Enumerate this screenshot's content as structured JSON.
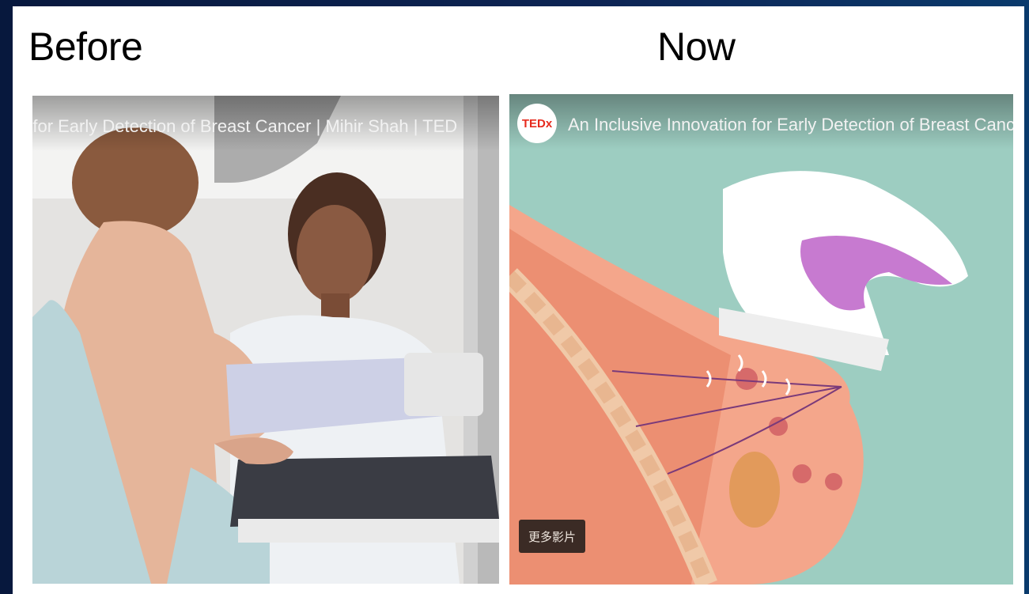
{
  "slide": {
    "before_heading": "Before",
    "now_heading": "Now"
  },
  "before_video": {
    "title": "n for Early Detection of Breast Cancer | Mihir Shah | TED"
  },
  "now_video": {
    "logo_text": "TEDx",
    "title": "An Inclusive Innovation for Early Detection of Breast Canc",
    "more_videos_label": "更多影片"
  }
}
